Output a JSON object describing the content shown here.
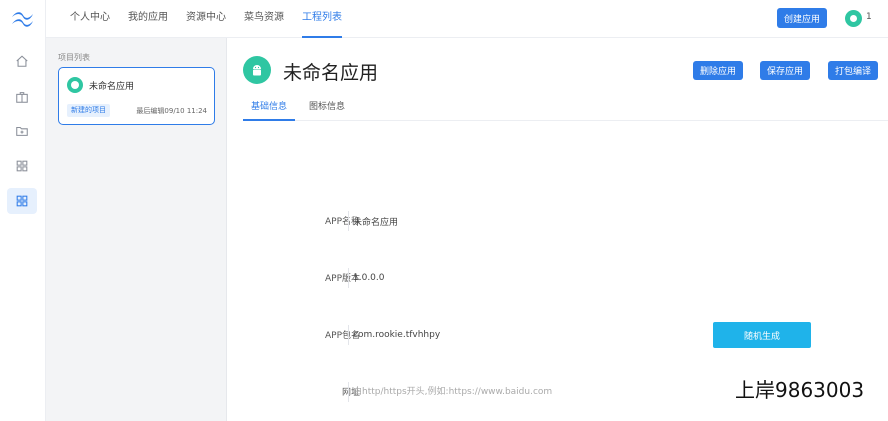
{
  "colors": {
    "accent": "#2f7ce8",
    "android_green": "#2fc6a2",
    "random_btn": "#1fb3ea"
  },
  "rail": {
    "logo": "tailwind-logo-icon",
    "items": [
      {
        "icon": "home-icon"
      },
      {
        "icon": "briefcase-icon"
      },
      {
        "icon": "folder-plus-icon"
      },
      {
        "icon": "grid-icon"
      },
      {
        "icon": "grid-icon",
        "active": true
      }
    ]
  },
  "topbar": {
    "nav": [
      {
        "label": "个人中心"
      },
      {
        "label": "我的应用"
      },
      {
        "label": "资源中心"
      },
      {
        "label": "菜鸟资源"
      },
      {
        "label": "工程列表",
        "active": true
      }
    ],
    "create_label": "创建应用",
    "avatar_count": "1"
  },
  "panel": {
    "title": "项目列表",
    "card": {
      "name": "未命名应用",
      "tag": "新建的项目",
      "time": "最后编辑09/10 11:24"
    }
  },
  "main": {
    "title": "未命名应用",
    "actions": [
      {
        "label": "删除应用"
      },
      {
        "label": "保存应用"
      },
      {
        "label": "打包编译"
      }
    ],
    "tabs": [
      {
        "label": "基础信息",
        "active": true
      },
      {
        "label": "图标信息"
      }
    ],
    "form": {
      "name": {
        "label": "APP名称",
        "value": "未命名应用"
      },
      "version": {
        "label": "APP版本",
        "value": "1.0.0.0"
      },
      "package": {
        "label": "APP包名",
        "value": "com.rookie.tfvhhpy"
      },
      "url": {
        "label": "网址",
        "placeholder": "由http/https开头,例如:https://www.baidu.com"
      },
      "random_label": "随机生成"
    }
  },
  "watermark": "上岸9863003"
}
